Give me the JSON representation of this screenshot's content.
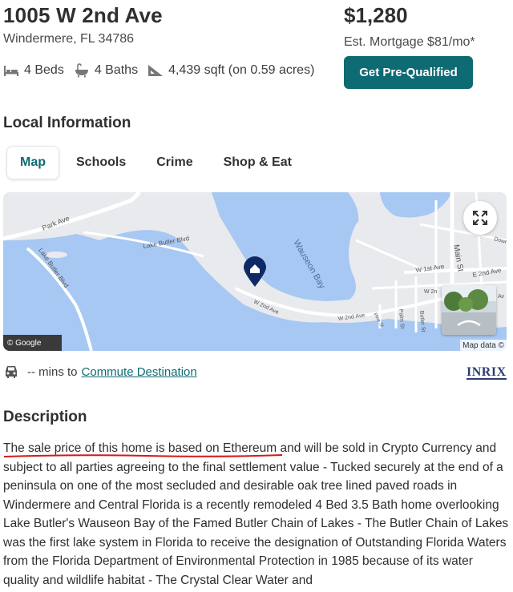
{
  "listing": {
    "address": "1005 W 2nd Ave",
    "city_state_zip": "Windermere, FL 34786",
    "price": "$1,280",
    "mortgage": "Est. Mortgage $81/mo*",
    "prequal_label": "Get Pre-Qualified",
    "beds": "4 Beds",
    "baths": "4 Baths",
    "sqft": "4,439 sqft (on 0.59 acres)"
  },
  "local": {
    "title": "Local Information",
    "tabs": [
      "Map",
      "Schools",
      "Crime",
      "Shop & Eat"
    ],
    "active_tab": "Map"
  },
  "map": {
    "labels": {
      "park_ave": "Park Ave",
      "lake_butler_blvd_1": "Lake Butler Blvd",
      "lake_butler_blvd_2": "Lake Butler Blvd",
      "wauseon_bay": "Wauseon Bay",
      "w2nd_ave_1": "W 2nd Ave",
      "w2nd_ave_2": "W 2nd Ave",
      "w1st_ave": "W 1st Ave",
      "main_st": "Main St",
      "e2nd_ave": "E 2nd Ave",
      "palm_st": "Palm St",
      "butler_st": "Butler St",
      "pine_st": "Pine St",
      "w2n": "W 2n",
      "st": "St",
      "down": "Dowr",
      "av": "Av"
    },
    "google_label": "© Google",
    "map_data_label": "Map data ©",
    "colors": {
      "water": "#a7c8f2",
      "land": "#e8eaed",
      "road": "#ffffff",
      "pin": "#0e2a66"
    }
  },
  "commute": {
    "prefix": "-- mins to",
    "link": "Commute Destination",
    "brand": "INRIX"
  },
  "description": {
    "title": "Description",
    "highlight": "The sale price of this home is based on Ethereum",
    "body": " and will be sold in Crypto Currency and subject to all parties agreeing to the final settlement value - Tucked securely at the end of a peninsula on one of the most secluded and desirable oak tree lined paved roads in Windermere and Central Florida is a recently remodeled 4 Bed 3.5 Bath home overlooking Lake Butler's Wauseon Bay of the Famed Butler Chain of Lakes - The Butler Chain of Lakes was the first lake system in Florida to receive the designation of Outstanding Florida Waters from the Florida Department of Environmental Protection in 1985 because of its water quality and wildlife habitat - The Crystal Clear Water and"
  },
  "accent_color": "#0f6b73"
}
